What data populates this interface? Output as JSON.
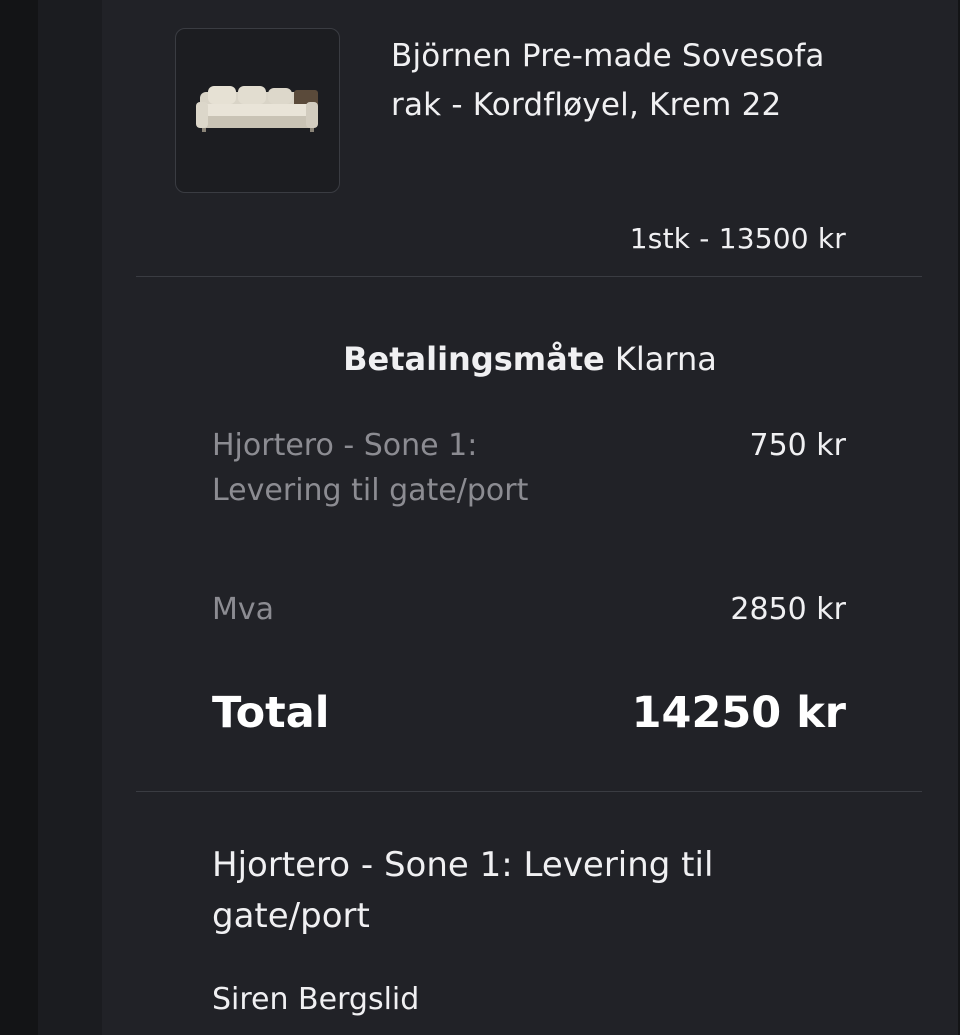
{
  "product": {
    "name": "Björnen Pre-made Sovesofa rak - Kordfløyel, Krem 22",
    "image_alt": "sofa-image",
    "qty_price": "1stk - 13500 kr"
  },
  "payment": {
    "label": "Betalingsmåte",
    "method": "Klarna"
  },
  "summary": {
    "shipping_label": "Hjortero - Sone 1: Levering til gate/port",
    "shipping_value": "750 kr",
    "vat_label": "Mva",
    "vat_value": "2850 kr",
    "total_label": "Total",
    "total_value": "14250 kr"
  },
  "delivery": {
    "title": "Hjortero - Sone 1: Levering til gate/port",
    "customer_name": "Siren Bergslid"
  },
  "colors": {
    "background": "#131416",
    "card": "#212227",
    "text": "#f0f0f2",
    "muted": "#8c8c92",
    "link": "#5f8fd8"
  }
}
